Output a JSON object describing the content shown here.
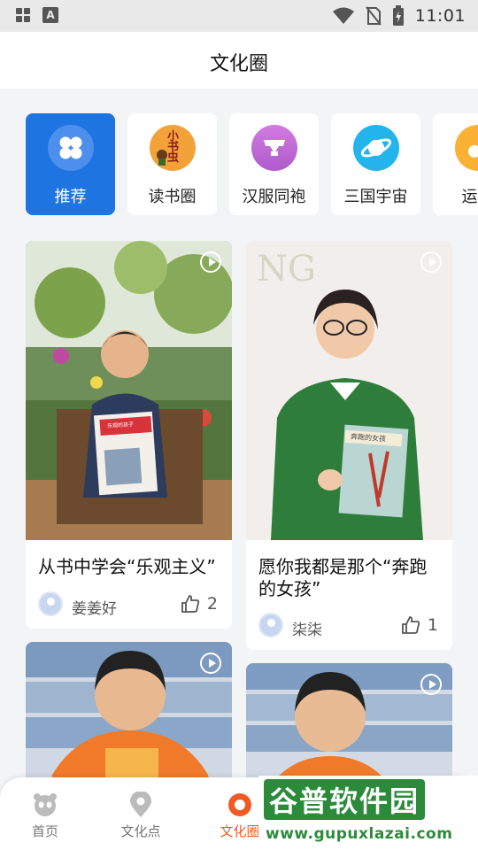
{
  "status_bar": {
    "time": "11:01",
    "badge_letter": "A"
  },
  "header": {
    "title": "文化圈"
  },
  "categories": [
    {
      "label": "推荐",
      "icon": "grid-icon",
      "active": true
    },
    {
      "label": "读书圈",
      "icon": "reading-icon",
      "icon_text": "小书虫"
    },
    {
      "label": "汉服同袍",
      "icon": "hanfu-icon"
    },
    {
      "label": "三国宇宙",
      "icon": "planet-icon"
    },
    {
      "label": "运动",
      "icon": "sports-icon"
    }
  ],
  "posts": [
    {
      "title": "从书中学会“乐观主义”",
      "author": "姜姜好",
      "likes": "2",
      "book_title": "乐观的孩子"
    },
    {
      "title": "愿你我都是那个“奔跑的女孩”",
      "author": "柒柒",
      "likes": "1",
      "book_title": "奔跑的女孩"
    },
    {
      "title": "",
      "author": "",
      "likes": ""
    },
    {
      "title": "",
      "author": "",
      "likes": ""
    }
  ],
  "bottom_nav": [
    {
      "label": "首页",
      "icon": "panda-icon"
    },
    {
      "label": "文化点",
      "icon": "location-pin-icon"
    },
    {
      "label": "文化圈",
      "icon": "circle-icon",
      "active": true
    },
    {
      "label": "",
      "icon": ""
    },
    {
      "label": "",
      "icon": ""
    }
  ],
  "watermark": {
    "logo": "谷普软件园",
    "url": "www.gupuxlazai.com"
  },
  "colors": {
    "accent_blue": "#1e74e0",
    "active_orange": "#f15a22",
    "page_bg": "#f3f4f6"
  }
}
